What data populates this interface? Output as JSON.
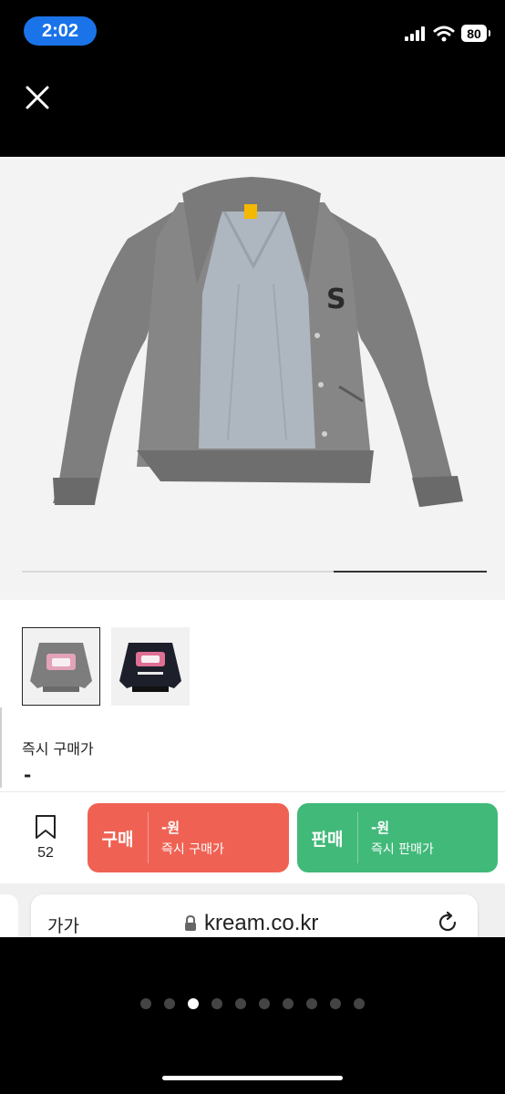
{
  "status_bar": {
    "time": "2:02",
    "battery": "80"
  },
  "product": {
    "main_image": "gray wool varsity jacket with S patch",
    "gallery_progress": 0.33,
    "thumbnails": [
      {
        "name": "gray-jacket-back",
        "selected": true
      },
      {
        "name": "black-jacket-back",
        "selected": false
      }
    ],
    "instant_price_label": "즉시 구매가",
    "instant_price_value": "-"
  },
  "action_bar": {
    "bookmark_count": "52",
    "buy": {
      "label": "구매",
      "price": "-원",
      "sub": "즉시 구매가",
      "color": "#ef6253"
    },
    "sell": {
      "label": "판매",
      "price": "-원",
      "sub": "즉시 판매가",
      "color": "#41b979"
    }
  },
  "browser": {
    "aa_label": "가가",
    "url": "kream.co.kr"
  },
  "pager": {
    "count": 10,
    "active_index": 2
  }
}
